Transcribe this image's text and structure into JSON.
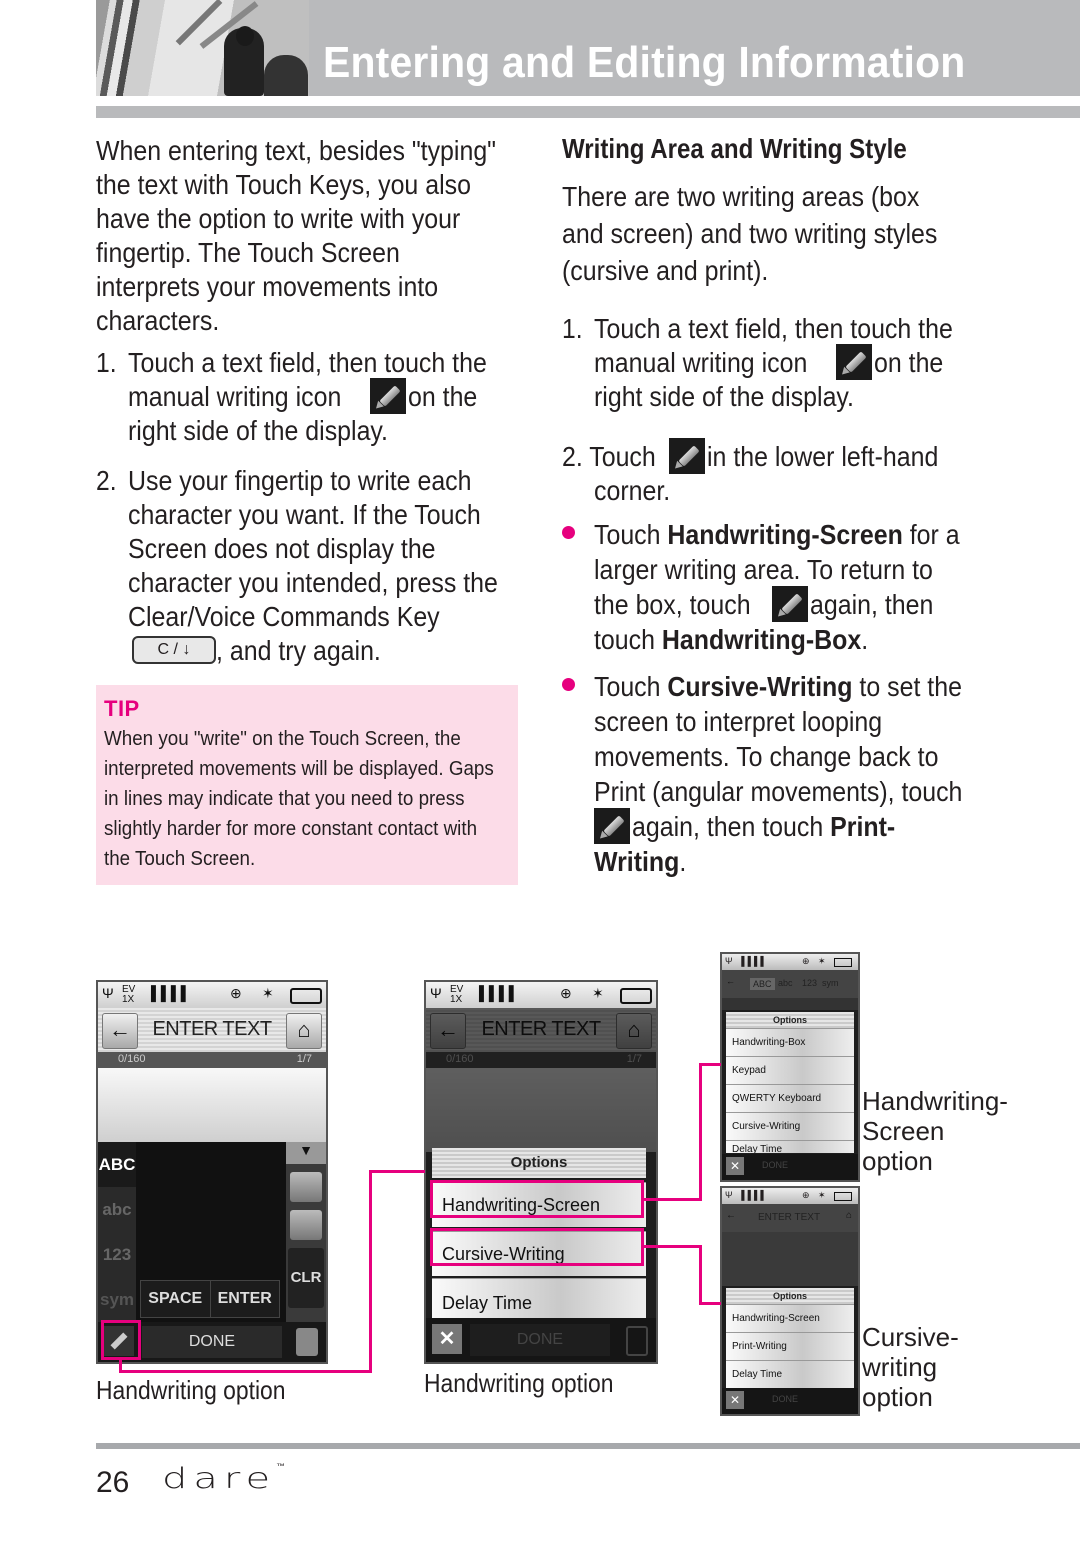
{
  "header": {
    "title": "Entering and Editing Information",
    "photo": "decorative-photo"
  },
  "left_column": {
    "intro_lines": [
      "When entering text, besides \"typing\"",
      "the text with Touch Keys, you also",
      "have the option to write with your",
      "fingertip. The Touch Screen",
      "interprets your movements into",
      "characters."
    ],
    "step1": {
      "num": "1.",
      "line1": "Touch a text field, then touch the",
      "line2_pre": "manual writing icon",
      "line2_post": "on the",
      "line3": "right side of the display."
    },
    "step2": {
      "num": "2.",
      "lines": [
        "Use your fingertip to write each",
        "character you want. If the Touch",
        "Screen does not display the",
        "character you intended, press the",
        "Clear/Voice Commands Key"
      ],
      "key_label": "C / ↓",
      "last_line": ", and try again."
    },
    "tip": {
      "title": "TIP",
      "lines": [
        "When you \"write\" on the Touch Screen, the",
        "interpreted movements will be displayed.  Gaps",
        "in lines may indicate that you need to press",
        "slightly harder for more constant contact with",
        "the Touch Screen."
      ]
    }
  },
  "right_column": {
    "heading": "Writing Area and Writing Style",
    "intro_lines": [
      "There are two writing areas (box",
      "and screen) and two writing styles",
      "(cursive and print)."
    ],
    "step1": {
      "num": "1.",
      "line1": "Touch a text field, then touch the",
      "line2_pre": "manual writing icon",
      "line2_post": "on the",
      "line3": "right side of the display."
    },
    "step2": {
      "pre": "2. Touch",
      "post": "in the lower left-hand",
      "line2": "corner."
    },
    "bullet1": {
      "l1_pre": "Touch ",
      "l1_bold": "Handwriting-Screen",
      "l1_post": " for a",
      "l2": "larger writing area. To return to",
      "l3_pre": "the box, touch",
      "l3_post": "again, then",
      "l4_pre": "touch ",
      "l4_bold": "Handwriting-Box",
      "l4_post": "."
    },
    "bullet2": {
      "l1_pre": "Touch ",
      "l1_bold": "Cursive-Writing",
      "l1_post": " to set the",
      "l2": "screen to interpret looping",
      "l3": "movements. To change back to",
      "l4": "Print (angular movements), touch",
      "l5_post": "again, then touch ",
      "l5_bold": "Print-",
      "l6_bold": "Writing",
      "l6_post": "."
    }
  },
  "screens": {
    "status_icons": {
      "signal": "Ψ",
      "network": "EV 1X",
      "bars": "▐▐▐▐",
      "gps": "⊕",
      "bluetooth": "✶",
      "battery": "▭"
    },
    "screen1": {
      "title": "ENTER TEXT",
      "counter": "0/160",
      "page": "1/7",
      "modes": [
        "ABC",
        "abc",
        "123",
        "sym"
      ],
      "space": "SPACE",
      "enter": "ENTER",
      "clr": "CLR",
      "done": "DONE",
      "caption": "Handwriting option"
    },
    "screen2": {
      "title": "ENTER TEXT",
      "counter": "0/160",
      "page": "1/7",
      "options_title": "Options",
      "options": [
        "Handwriting-Screen",
        "Cursive-Writing",
        "Delay Time"
      ],
      "done": "DONE",
      "caption": "Handwriting option"
    },
    "screen3": {
      "tabs": [
        "ABC",
        "abc",
        "123",
        "sym"
      ],
      "options_title": "Options",
      "options": [
        "Handwriting-Box",
        "Keypad",
        "QWERTY Keyboard",
        "Cursive-Writing",
        "Delay Time"
      ],
      "done": "DONE",
      "caption_lines": [
        "Handwriting-",
        "Screen",
        "option"
      ]
    },
    "screen4": {
      "title": "ENTER TEXT",
      "options_title": "Options",
      "options": [
        "Handwriting-Screen",
        "Print-Writing",
        "Delay Time"
      ],
      "done": "DONE",
      "caption_lines": [
        "Cursive-",
        "writing",
        "option"
      ]
    }
  },
  "footer": {
    "page_number": "26",
    "brand": "Dare",
    "trademark": "™"
  },
  "colors": {
    "accent_magenta": "#e6007e",
    "tip_background": "#fcdce8",
    "header_gray": "#b9babc"
  }
}
